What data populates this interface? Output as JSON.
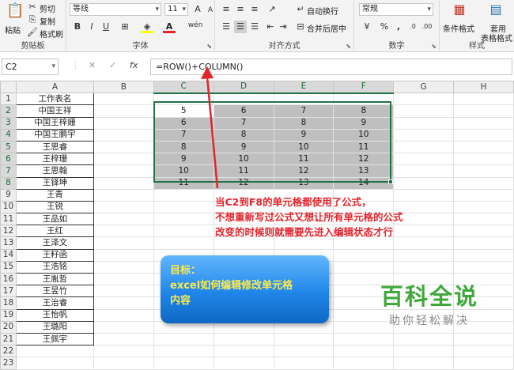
{
  "ribbon": {
    "clipboard": {
      "paste": "粘贴",
      "cut": "剪切",
      "copy": "复制",
      "format_painter": "格式刷",
      "group": "剪贴板"
    },
    "font": {
      "name": "等线",
      "size": "11",
      "bold": "B",
      "italic": "I",
      "underline": "U",
      "group": "字体",
      "wen": "wén"
    },
    "alignment": {
      "wrap": "自动换行",
      "merge": "合并后居中",
      "group": "对齐方式"
    },
    "number": {
      "format": "常规",
      "percent": "%",
      "comma": ",",
      "group": "数字"
    },
    "styles": {
      "conditional": "条件格式",
      "table1": "套用",
      "table2": "表格格式",
      "group": "样式"
    }
  },
  "formula_bar": {
    "name_box": "C2",
    "cancel": "✕",
    "enter": "✓",
    "fx": "fx",
    "formula": "=ROW()+COLUMN()"
  },
  "columns": [
    "A",
    "B",
    "C",
    "D",
    "E",
    "F",
    "G",
    "H"
  ],
  "rows": [
    {
      "n": "1",
      "a": "工作表名",
      "v": [
        "",
        "",
        "",
        ""
      ]
    },
    {
      "n": "2",
      "a": "中国王祥",
      "v": [
        "5",
        "6",
        "7",
        "8"
      ]
    },
    {
      "n": "3",
      "a": "中国王梓姗",
      "v": [
        "6",
        "7",
        "8",
        "9"
      ]
    },
    {
      "n": "4",
      "a": "中国王鹏宇",
      "v": [
        "7",
        "8",
        "9",
        "10"
      ]
    },
    {
      "n": "5",
      "a": "王思睿",
      "v": [
        "8",
        "9",
        "10",
        "11"
      ]
    },
    {
      "n": "6",
      "a": "王梓珊",
      "v": [
        "9",
        "10",
        "11",
        "12"
      ]
    },
    {
      "n": "7",
      "a": "王思翰",
      "v": [
        "10",
        "11",
        "12",
        "13"
      ]
    },
    {
      "n": "8",
      "a": "王铎坤",
      "v": [
        "11",
        "12",
        "13",
        "14"
      ]
    },
    {
      "n": "9",
      "a": "王青",
      "v": [
        "",
        "",
        "",
        ""
      ]
    },
    {
      "n": "10",
      "a": "王锐",
      "v": [
        "",
        "",
        "",
        ""
      ]
    },
    {
      "n": "11",
      "a": "王品如",
      "v": [
        "",
        "",
        "",
        ""
      ]
    },
    {
      "n": "12",
      "a": "王红",
      "v": [
        "",
        "",
        "",
        ""
      ]
    },
    {
      "n": "13",
      "a": "王泽文",
      "v": [
        "",
        "",
        "",
        ""
      ]
    },
    {
      "n": "14",
      "a": "王籽函",
      "v": [
        "",
        "",
        "",
        ""
      ]
    },
    {
      "n": "15",
      "a": "王浩铭",
      "v": [
        "",
        "",
        "",
        ""
      ]
    },
    {
      "n": "16",
      "a": "王胤哲",
      "v": [
        "",
        "",
        "",
        ""
      ]
    },
    {
      "n": "17",
      "a": "王昱竹",
      "v": [
        "",
        "",
        "",
        ""
      ]
    },
    {
      "n": "18",
      "a": "王治睿",
      "v": [
        "",
        "",
        "",
        ""
      ]
    },
    {
      "n": "19",
      "a": "王怡帆",
      "v": [
        "",
        "",
        "",
        ""
      ]
    },
    {
      "n": "20",
      "a": "王璐阳",
      "v": [
        "",
        "",
        "",
        ""
      ]
    },
    {
      "n": "21",
      "a": "王佩宇",
      "v": [
        "",
        "",
        "",
        ""
      ]
    },
    {
      "n": "22",
      "a": "",
      "v": [
        "",
        "",
        "",
        ""
      ]
    },
    {
      "n": "23",
      "a": "",
      "v": [
        "",
        "",
        "",
        ""
      ]
    }
  ],
  "annotation": {
    "line1": "当C2到F8的单元格都使用了公式，",
    "line2": "不想重新写过公式又想让所有单元格的公式",
    "line3": "改变的时候则就需要先进入编辑状态才行",
    "color": "#e3242b"
  },
  "goal": {
    "line1": "目标：",
    "line2": "excel如何编辑修改单元格",
    "line3": "内容"
  },
  "watermark": {
    "title": "百科全说",
    "subtitle": "助你轻松解决"
  }
}
